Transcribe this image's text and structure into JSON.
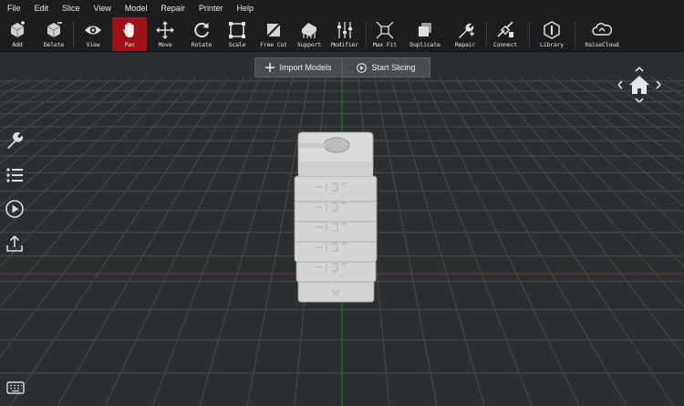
{
  "menu": [
    "File",
    "Edit",
    "Slice",
    "View",
    "Model",
    "Repair",
    "Printer",
    "Help"
  ],
  "toolbar": [
    {
      "id": "add",
      "label": "Add",
      "icon": "add-icon"
    },
    {
      "id": "delete",
      "label": "Delete",
      "icon": "delete-icon"
    },
    {
      "id": "view",
      "label": "View",
      "icon": "eye-icon"
    },
    {
      "id": "pan",
      "label": "Pan",
      "icon": "hand-icon",
      "active": true
    },
    {
      "id": "move",
      "label": "Move",
      "icon": "move-icon"
    },
    {
      "id": "rotate",
      "label": "Rotate",
      "icon": "rotate-icon"
    },
    {
      "id": "scale",
      "label": "Scale",
      "icon": "scale-icon"
    },
    {
      "id": "freecut",
      "label": "Free Cut",
      "icon": "cut-icon"
    },
    {
      "id": "support",
      "label": "Support",
      "icon": "support-icon"
    },
    {
      "id": "modifier",
      "label": "Modifier",
      "icon": "sliders-icon"
    },
    {
      "id": "maxfit",
      "label": "Max Fit",
      "icon": "maxfit-icon"
    },
    {
      "id": "duplicate",
      "label": "Duplicate",
      "icon": "duplicate-icon"
    },
    {
      "id": "repair",
      "label": "Repair",
      "icon": "wrench-icon"
    },
    {
      "id": "connect",
      "label": "Connect",
      "icon": "connect-icon"
    },
    {
      "id": "library",
      "label": "Library",
      "icon": "library-icon"
    },
    {
      "id": "raisecloud",
      "label": "RaiseCloud",
      "icon": "cloud-icon"
    }
  ],
  "actions": {
    "import": "Import Models",
    "slice": "Start Slicing"
  },
  "colors": {
    "accent": "#a01218",
    "background": "#2c2f31",
    "toolbar": "#1b1d1f",
    "grid": "#45484b",
    "axis_x": "#8a2b2b",
    "axis_y": "#2e7a34",
    "model": "#d2d2d2"
  },
  "sidebar": [
    "wrench-icon",
    "list-icon",
    "play-icon",
    "upload-icon"
  ],
  "bottom": [
    "keyboard-icon"
  ]
}
